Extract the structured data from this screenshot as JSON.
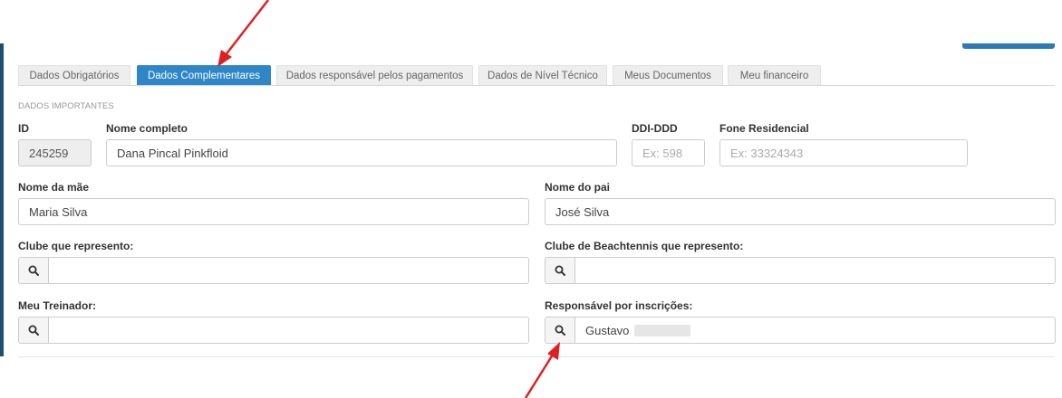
{
  "tabs": [
    {
      "label": "Dados Obrigatórios",
      "active": false
    },
    {
      "label": "Dados Complementares",
      "active": true
    },
    {
      "label": "Dados responsável pelos pagamentos",
      "active": false
    },
    {
      "label": "Dados de Nível Técnico",
      "active": false
    },
    {
      "label": "Meus Documentos",
      "active": false
    },
    {
      "label": "Meu financeiro",
      "active": false
    }
  ],
  "section_title": "DADOS IMPORTANTES",
  "fields": {
    "id": {
      "label": "ID",
      "value": "245259"
    },
    "nome_completo": {
      "label": "Nome completo",
      "value": "Dana Pincal Pinkfloid"
    },
    "ddi_ddd": {
      "label": "DDI-DDD",
      "placeholder": "Ex: 598"
    },
    "fone_residencial": {
      "label": "Fone Residencial",
      "placeholder": "Ex: 33324343"
    },
    "nome_mae": {
      "label": "Nome da mãe",
      "value": "Maria Silva"
    },
    "nome_pai": {
      "label": "Nome do pai",
      "value": "José Silva"
    },
    "clube": {
      "label": "Clube que represento:",
      "value": ""
    },
    "clube_beach": {
      "label": "Clube de Beachtennis que represento:",
      "value": ""
    },
    "treinador": {
      "label": "Meu Treinador:",
      "value": ""
    },
    "responsavel": {
      "label": "Responsável por inscrições:",
      "value": "Gustavo"
    }
  },
  "icons": {
    "search": "search-icon",
    "annotation": "red-arrow-icon"
  },
  "colors": {
    "accent": "#2e86c9",
    "annotation": "#e02020",
    "sidebar": "#1f4e6e"
  }
}
